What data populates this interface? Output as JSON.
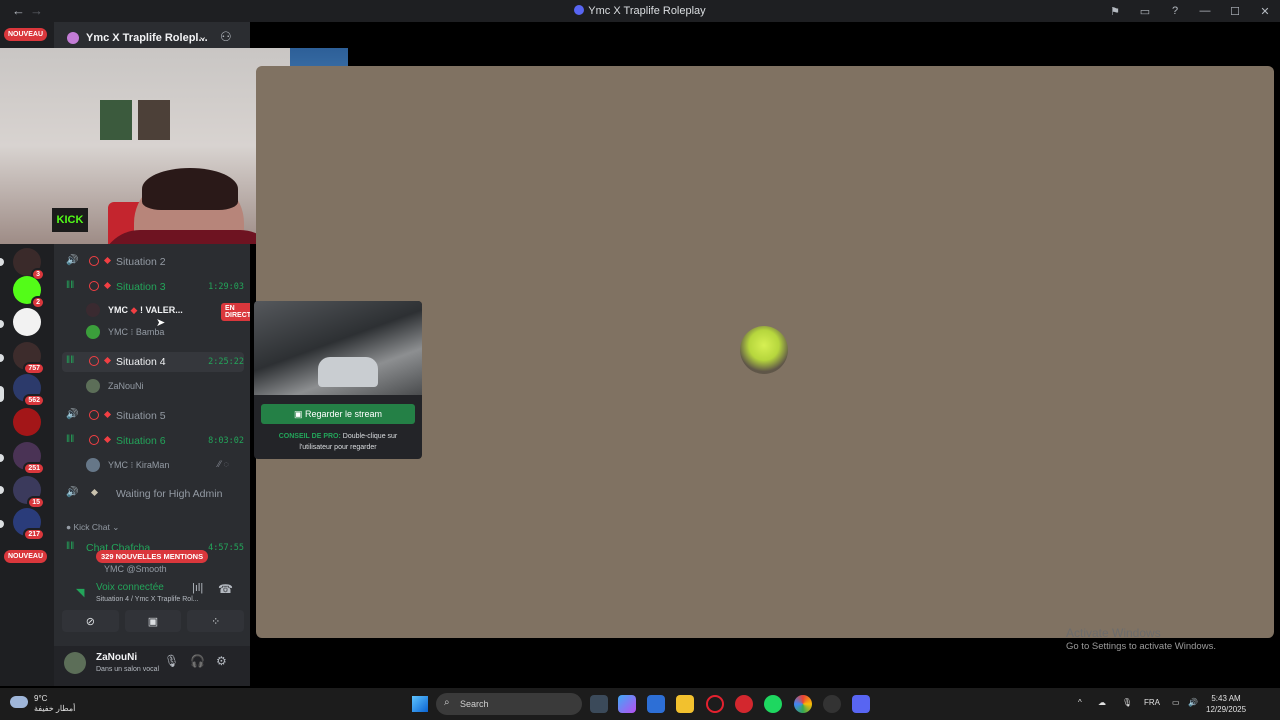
{
  "window": {
    "title": "Ymc X Traplife Roleplay"
  },
  "server": {
    "name": "Ymc X Traplife Rolepl..."
  },
  "server_badges": {
    "nouveau_top": "NOUVEAU",
    "nouveau_bottom": "NOUVEAU",
    "counts": [
      "3",
      "2",
      "757",
      "562",
      "251",
      "15",
      "217"
    ]
  },
  "channels": [
    {
      "name": "Situation 2",
      "time": ""
    },
    {
      "name": "Situation 3",
      "time": "1:29:03"
    },
    {
      "name": "Situation 4",
      "time": "2:25:22"
    },
    {
      "name": "Situation 5",
      "time": ""
    },
    {
      "name": "Situation 6",
      "time": "8:03:02"
    },
    {
      "name": "Waiting for High Admin",
      "time": ""
    },
    {
      "name": "Chat Chafcha",
      "time": "4:57:55"
    }
  ],
  "users": {
    "s3_user1_prefix": "YMC",
    "s3_user1_name": "! VALER...",
    "s3_user1_badge": "EN DIRECT",
    "s3_user2_prefix": "YMC",
    "s3_user2_name": "Bamba",
    "s4_user1_name": "ZaNouNi",
    "s6_user1_prefix": "YMC",
    "s6_user1_name": "KiraMan",
    "chat_user1": "YMC  @Smooth"
  },
  "category": {
    "name": "Kick Chat"
  },
  "mentions": "329 NOUVELLES MENTIONS",
  "voice": {
    "status": "Voix connectée",
    "channel": "Situation 4 / Ymc X Traplife Rol..."
  },
  "profile": {
    "name": "ZaNouNi",
    "status": "Dans un salon vocal"
  },
  "stream_popup": {
    "watch_button": "Regarder le stream",
    "tip_label": "CONSEIL DE PRO:",
    "tip_text": "Double-clique sur l'utilisateur pour regarder"
  },
  "webcam": {
    "sign": "KICK"
  },
  "watermark": {
    "line1": "Activate Windows",
    "line2": "Go to Settings to activate Windows."
  },
  "taskbar": {
    "temp": "9°C",
    "weather_text": "أمطار خفيفة",
    "search_placeholder": "Search",
    "lang": "FRA",
    "time": "5:43 AM",
    "date": "12/29/2025"
  }
}
